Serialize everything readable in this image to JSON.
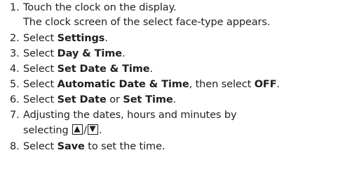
{
  "steps": [
    {
      "num": "1.",
      "text": "Touch the clock on the display."
    },
    {
      "text": "The clock screen of the select face-type appears."
    },
    {
      "num": "2.",
      "pre": "Select ",
      "b1": "Settings",
      "post": "."
    },
    {
      "num": "3.",
      "pre": "Select ",
      "b1": "Day & Time",
      "post": "."
    },
    {
      "num": "4.",
      "pre": "Select ",
      "b1": "Set Date & Time",
      "post": "."
    },
    {
      "num": "5.",
      "pre": "Select ",
      "b1": "Automatic Date & Time",
      "mid": ", then select ",
      "b2": "OFF",
      "post": "."
    },
    {
      "num": "6.",
      "pre": "Select ",
      "b1": "Set Date",
      "mid": " or ",
      "b2": "Set Time",
      "post": "."
    },
    {
      "num": "7.",
      "text": "Adjusting the dates, hours and minutes by"
    },
    {
      "pre": "selecting ",
      "slash": "/",
      "post": "."
    },
    {
      "num": "8.",
      "pre": "Select ",
      "b1": "Save",
      "post": " to set the time."
    }
  ],
  "icons": [
    "up-arrow-button-icon",
    "down-arrow-button-icon"
  ]
}
